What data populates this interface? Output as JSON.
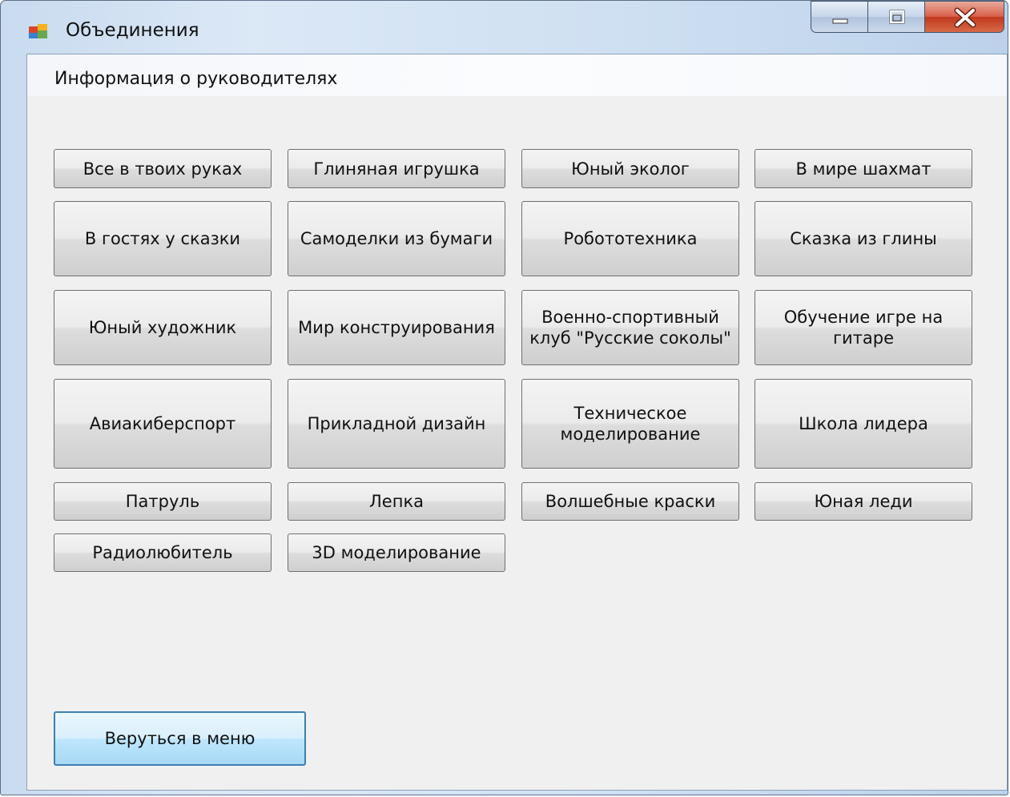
{
  "window": {
    "title": "Объединения"
  },
  "menu": {
    "label": "Информация о руководителях"
  },
  "buttons": {
    "b0": "Все в твоих руках",
    "b1": "Глиняная игрушка",
    "b2": "Юный эколог",
    "b3": "В мире шахмат",
    "b4": "В гостях у сказки",
    "b5": "Самоделки из бумаги",
    "b6": "Робототехника",
    "b7": "Сказка из глины",
    "b8": "Юный художник",
    "b9": "Мир конструирования",
    "b10": "Военно-спортивный клуб \"Русские соколы\"",
    "b11": "Обучение игре на гитаре",
    "b12": "Авиакиберспорт",
    "b13": "Прикладной дизайн",
    "b14": "Техническое моделирование",
    "b15": "Школа лидера",
    "b16": "Патруль",
    "b17": "Лепка",
    "b18": "Волшебные краски",
    "b19": "Юная леди",
    "b20": "Радиолюбитель",
    "b21": "3D моделирование"
  },
  "back_button": "Веруться в меню",
  "icons": {
    "app": "form-app-icon",
    "minimize": "minimize-icon",
    "maximize": "maximize-icon",
    "close": "close-icon"
  }
}
